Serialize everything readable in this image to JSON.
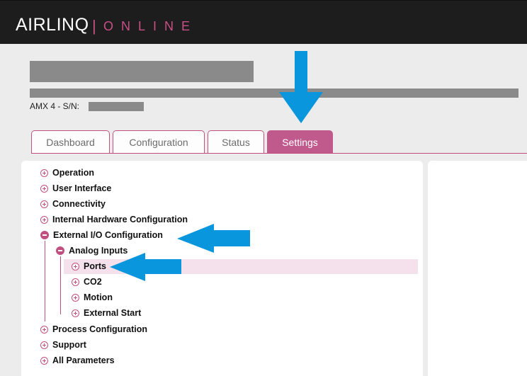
{
  "header": {
    "brand": "AIRLINQ",
    "separator": "|",
    "subbrand": "ONLINE"
  },
  "device": {
    "model_label": "AMX 4 - S/N:"
  },
  "tabs": [
    {
      "label": "Dashboard",
      "active": false
    },
    {
      "label": "Configuration",
      "active": false
    },
    {
      "label": "Status",
      "active": false
    },
    {
      "label": "Settings",
      "active": true
    }
  ],
  "tree": {
    "items": [
      {
        "label": "Operation",
        "state": "collapsed"
      },
      {
        "label": "User Interface",
        "state": "collapsed"
      },
      {
        "label": "Connectivity",
        "state": "collapsed"
      },
      {
        "label": "Internal Hardware Configuration",
        "state": "collapsed"
      },
      {
        "label": "External I/O Configuration",
        "state": "expanded"
      },
      {
        "label": "Analog Inputs",
        "state": "expanded"
      },
      {
        "label": "Ports",
        "state": "collapsed",
        "selected": true
      },
      {
        "label": "CO2",
        "state": "collapsed"
      },
      {
        "label": "Motion",
        "state": "collapsed"
      },
      {
        "label": "External Start",
        "state": "collapsed"
      },
      {
        "label": "Process Configuration",
        "state": "collapsed"
      },
      {
        "label": "Support",
        "state": "collapsed"
      },
      {
        "label": "All Parameters",
        "state": "collapsed"
      }
    ]
  },
  "colors": {
    "accent": "#c0507f",
    "header_bg": "#1d1d1d",
    "annotation_arrow": "#0a96dc",
    "selected_row": "#f4e1eb",
    "redaction": "#8a8a8a"
  }
}
